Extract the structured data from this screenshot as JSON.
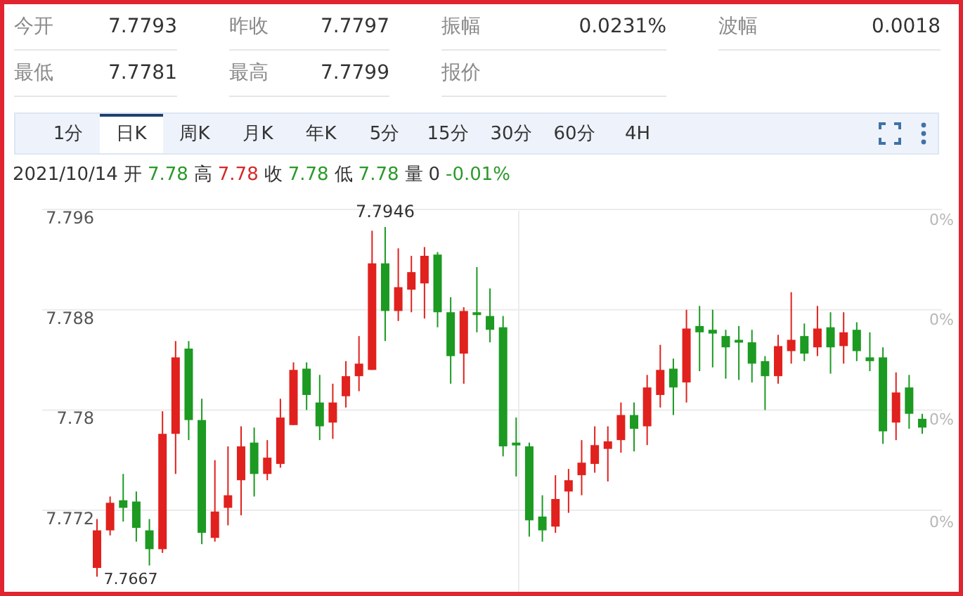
{
  "stats": [
    {
      "label": "今开",
      "value": "7.7793"
    },
    {
      "label": "昨收",
      "value": "7.7797"
    },
    {
      "label": "振幅",
      "value": "0.0231%"
    },
    {
      "label": "波幅",
      "value": "0.0018"
    },
    {
      "label": "最低",
      "value": "7.7781"
    },
    {
      "label": "最高",
      "value": "7.7799"
    },
    {
      "label": "报价"
    }
  ],
  "tabs": [
    {
      "label": "1分",
      "selected": false
    },
    {
      "label": "日K",
      "selected": true
    },
    {
      "label": "周K",
      "selected": false
    },
    {
      "label": "月K",
      "selected": false
    },
    {
      "label": "年K",
      "selected": false
    },
    {
      "label": "5分",
      "selected": false
    },
    {
      "label": "15分",
      "selected": false
    },
    {
      "label": "30分",
      "selected": false
    },
    {
      "label": "60分",
      "selected": false
    },
    {
      "label": "4H",
      "selected": false
    }
  ],
  "quote": {
    "date": "2021/10/14",
    "items": [
      {
        "label": "开",
        "value": "7.78",
        "color": "#2a9a2a"
      },
      {
        "label": "高",
        "value": "7.78",
        "color": "#d42a2a"
      },
      {
        "label": "收",
        "value": "7.78",
        "color": "#2a9a2a"
      },
      {
        "label": "低",
        "value": "7.78",
        "color": "#2a9a2a"
      },
      {
        "label": "量",
        "value": "0",
        "color": "#333333"
      },
      {
        "value": "-0.01%",
        "color": "#2a9a2a"
      }
    ]
  },
  "chart": {
    "right_labels": [
      "0%",
      "0%",
      "0%",
      "0%"
    ],
    "high_label": "7.7946",
    "low_label": "7.7667",
    "chart_data": {
      "type": "candlestick",
      "yticks": [
        7.796,
        7.788,
        7.78,
        7.772
      ],
      "ylim": [
        7.7655,
        7.796
      ],
      "grid": true,
      "ohlc": [
        [
          7.7674,
          7.7713,
          7.7667,
          7.7704
        ],
        [
          7.7704,
          7.7731,
          7.77,
          7.7726
        ],
        [
          7.7728,
          7.7749,
          7.7711,
          7.7722
        ],
        [
          7.7727,
          7.7735,
          7.7695,
          7.7706
        ],
        [
          7.7704,
          7.7713,
          7.7676,
          7.7689
        ],
        [
          7.7689,
          7.7799,
          7.7686,
          7.7781
        ],
        [
          7.7781,
          7.7855,
          7.7749,
          7.7842
        ],
        [
          7.7849,
          7.7855,
          7.7776,
          7.7792
        ],
        [
          7.7792,
          7.7809,
          7.7693,
          7.7702
        ],
        [
          7.7698,
          7.776,
          7.7695,
          7.7719
        ],
        [
          7.7722,
          7.7771,
          7.7708,
          7.7732
        ],
        [
          7.7744,
          7.7787,
          7.7716,
          7.7771
        ],
        [
          7.7774,
          7.7786,
          7.7731,
          7.7749
        ],
        [
          7.7749,
          7.7776,
          7.7744,
          7.7762
        ],
        [
          7.7757,
          7.7809,
          7.7754,
          7.7794
        ],
        [
          7.7788,
          7.7838,
          7.7788,
          7.7832
        ],
        [
          7.7833,
          7.7838,
          7.78,
          7.7812
        ],
        [
          7.7806,
          7.7828,
          7.7776,
          7.7787
        ],
        [
          7.779,
          7.7821,
          7.7777,
          7.7806
        ],
        [
          7.7811,
          7.7839,
          7.7802,
          7.7827
        ],
        [
          7.7827,
          7.7859,
          7.7815,
          7.7837
        ],
        [
          7.7832,
          7.7943,
          7.7832,
          7.7917
        ],
        [
          7.7917,
          7.7946,
          7.7855,
          7.7879
        ],
        [
          7.7879,
          7.7929,
          7.7871,
          7.7898
        ],
        [
          7.7896,
          7.7923,
          7.7878,
          7.791
        ],
        [
          7.7901,
          7.793,
          7.7873,
          7.7923
        ],
        [
          7.7924,
          7.7926,
          7.7866,
          7.7878
        ],
        [
          7.7878,
          7.789,
          7.7821,
          7.7843
        ],
        [
          7.7845,
          7.7882,
          7.7821,
          7.7879
        ],
        [
          7.7878,
          7.7914,
          7.7862,
          7.7876
        ],
        [
          7.7875,
          7.7897,
          7.7854,
          7.7864
        ],
        [
          7.7866,
          7.7875,
          7.7763,
          7.7771
        ],
        [
          7.7774,
          7.7794,
          7.7747,
          7.7772
        ],
        [
          7.7771,
          7.7774,
          7.7699,
          7.7712
        ],
        [
          7.7715,
          7.7732,
          7.7695,
          7.7704
        ],
        [
          7.7707,
          7.7748,
          7.7702,
          7.7729
        ],
        [
          7.7735,
          7.7753,
          7.7718,
          7.7744
        ],
        [
          7.7748,
          7.7776,
          7.7732,
          7.7758
        ],
        [
          7.7757,
          7.7787,
          7.775,
          7.7772
        ],
        [
          7.7769,
          7.7787,
          7.7743,
          7.7775
        ],
        [
          7.7776,
          7.7806,
          7.7766,
          7.7796
        ],
        [
          7.7796,
          7.7806,
          7.7767,
          7.7785
        ],
        [
          7.7787,
          7.7828,
          7.7772,
          7.7818
        ],
        [
          7.7812,
          7.7852,
          7.7802,
          7.7832
        ],
        [
          7.7833,
          7.7841,
          7.7796,
          7.7818
        ],
        [
          7.7822,
          7.788,
          7.7806,
          7.7865
        ],
        [
          7.7867,
          7.7883,
          7.7831,
          7.7862
        ],
        [
          7.7864,
          7.788,
          7.7834,
          7.7861
        ],
        [
          7.7859,
          7.7864,
          7.7825,
          7.785
        ],
        [
          7.7856,
          7.7867,
          7.7824,
          7.7855
        ],
        [
          7.7854,
          7.7864,
          7.7822,
          7.7837
        ],
        [
          7.7839,
          7.7843,
          7.78,
          7.7827
        ],
        [
          7.7827,
          7.786,
          7.7821,
          7.7851
        ],
        [
          7.7847,
          7.7894,
          7.7837,
          7.7856
        ],
        [
          7.7859,
          7.7869,
          7.7839,
          7.7845
        ],
        [
          7.785,
          7.7883,
          7.7843,
          7.7865
        ],
        [
          7.7866,
          7.7878,
          7.7829,
          7.785
        ],
        [
          7.7851,
          7.7878,
          7.7837,
          7.7862
        ],
        [
          7.7864,
          7.787,
          7.7839,
          7.7847
        ],
        [
          7.7842,
          7.7862,
          7.7831,
          7.7839
        ],
        [
          7.7842,
          7.785,
          7.7773,
          7.7783
        ],
        [
          7.779,
          7.783,
          7.7776,
          7.7814
        ],
        [
          7.7818,
          7.7828,
          7.7785,
          7.7797
        ],
        [
          7.7793,
          7.7797,
          7.7781,
          7.7786
        ]
      ]
    }
  }
}
